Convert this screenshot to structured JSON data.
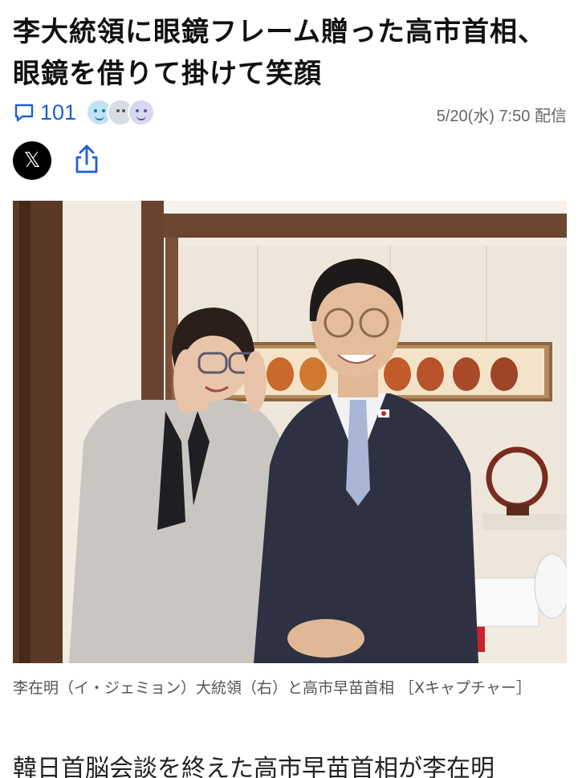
{
  "article": {
    "headline": "李大統領に眼鏡フレーム贈った高市首相、眼鏡を借りて掛けて笑顔",
    "comment_count": "101",
    "date": "5/20(水) 7:50 配信",
    "share": {
      "x_label": "𝕏"
    },
    "photo": {
      "alt": "",
      "caption": "李在明（イ・ジェミョン）大統領（右）と高市早苗首相 ［Xキャプチャー］"
    },
    "body_first_line": "韓日首脳会談を終えた高市早苗首相が李在明"
  },
  "colors": {
    "accent": "#1d5fd6",
    "reaction_1": "#bfe3f5",
    "reaction_2": "#d8dde3",
    "reaction_3": "#d9d6f2"
  }
}
